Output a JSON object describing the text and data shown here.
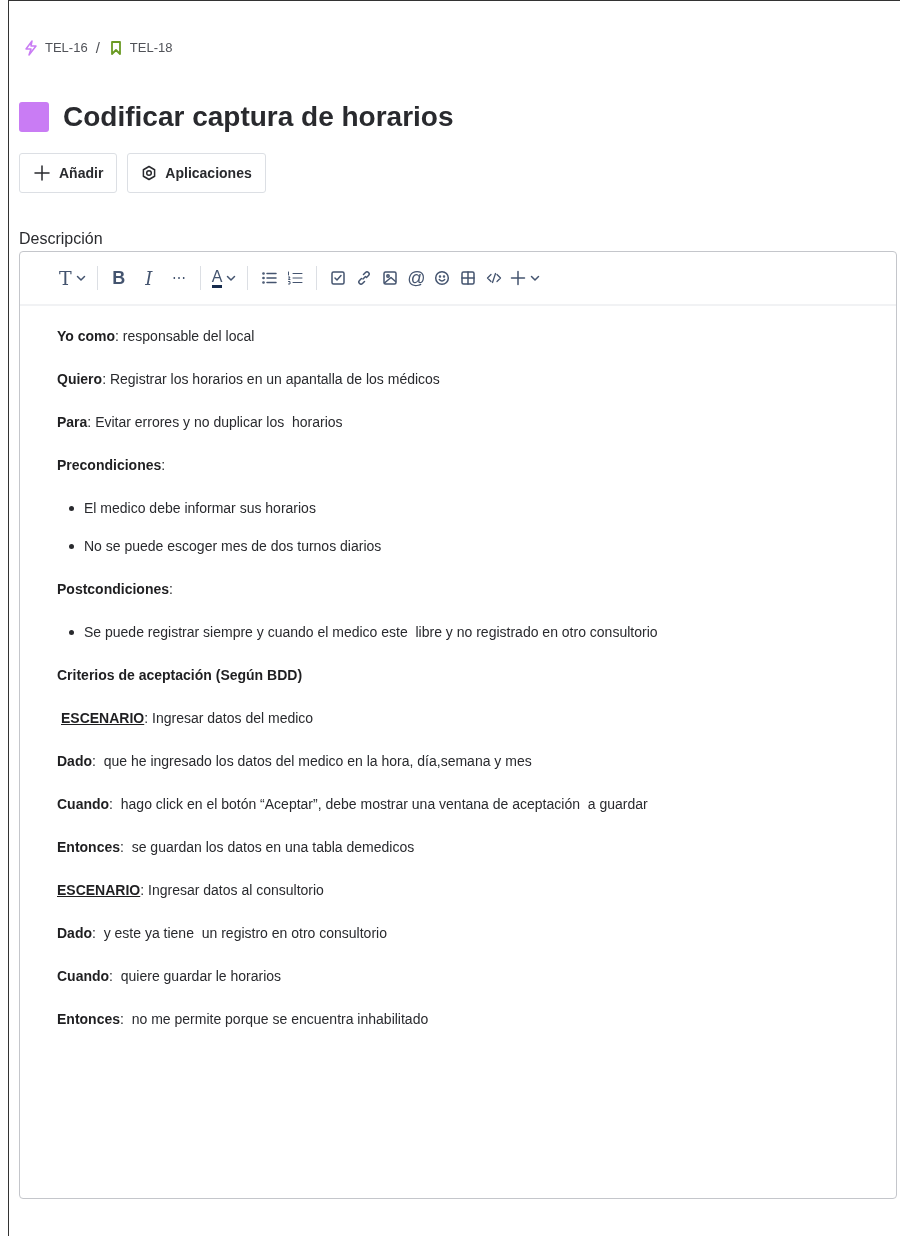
{
  "breadcrumbs": [
    {
      "label": "TEL-16"
    },
    {
      "label": "TEL-18"
    }
  ],
  "breadcrumb_separator": "/",
  "title": "Codificar captura de horarios",
  "buttons": [
    {
      "label": "Añadir"
    },
    {
      "label": "Aplicaciones"
    }
  ],
  "description_label": "Descripción",
  "toolbar": {
    "text_style": "T",
    "bold": "B",
    "italic": "I",
    "more": "⋯",
    "text_color": "A",
    "mention": "@"
  },
  "content": [
    {
      "kind": "paragraph",
      "label": "Yo como",
      "text": ": responsable del local"
    },
    {
      "kind": "paragraph",
      "label": "Quiero",
      "text": ": Registrar los horarios en un apantalla de los médicos"
    },
    {
      "kind": "paragraph",
      "label": "Para",
      "text": ": Evitar errores y no duplicar los  horarios"
    },
    {
      "kind": "paragraph",
      "label": "Precondiciones",
      "text": ":"
    },
    {
      "kind": "bullet",
      "text": "El medico debe informar sus horarios"
    },
    {
      "kind": "bullet",
      "text": "No se puede escoger mes de dos turnos diarios"
    },
    {
      "kind": "paragraph",
      "label": "Postcondiciones",
      "text": ":"
    },
    {
      "kind": "bullet",
      "text": "Se puede registrar siempre y cuando el medico este  libre y no registrado en otro consultorio"
    },
    {
      "kind": "heading",
      "text": "Criterios de aceptación (Según BDD)"
    },
    {
      "kind": "scenario",
      "indented": true,
      "label": "ESCENARIO",
      "text": ": Ingresar datos del medico"
    },
    {
      "kind": "paragraph",
      "label": "Dado",
      "text": ":  que he ingresado los datos del medico en la hora, día,semana y mes"
    },
    {
      "kind": "paragraph",
      "label": "Cuando",
      "text": ":  hago click en el botón “Aceptar”, debe mostrar una ventana de aceptación  a guardar"
    },
    {
      "kind": "paragraph",
      "label": "Entonces",
      "text": ":  se guardan los datos en una tabla demedicos"
    },
    {
      "kind": "scenario",
      "label": "ESCENARIO",
      "text": ": Ingresar datos al consultorio"
    },
    {
      "kind": "paragraph",
      "label": "Dado",
      "text": ":  y este ya tiene  un registro en otro consultorio"
    },
    {
      "kind": "paragraph",
      "label": "Cuando",
      "text": ":  quiere guardar le horarios"
    },
    {
      "kind": "paragraph",
      "label": "Entonces",
      "text": ":  no me permite porque se encuentra inhabilitado"
    }
  ]
}
